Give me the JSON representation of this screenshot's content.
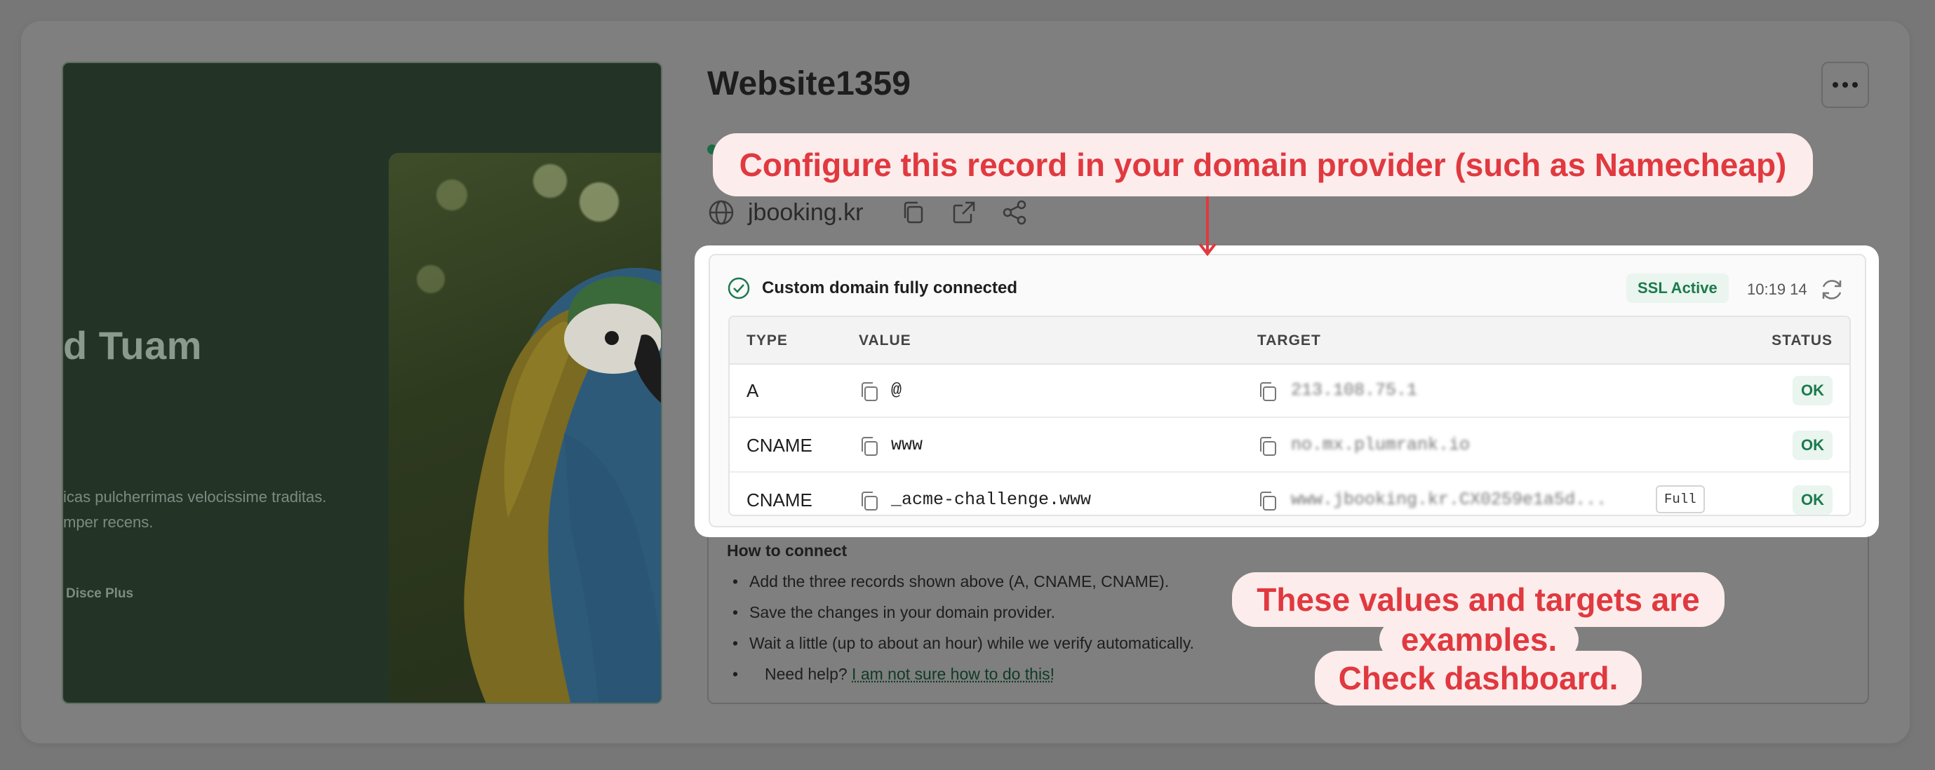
{
  "site": {
    "title": "Website1359",
    "domain": "jbooking.kr"
  },
  "preview": {
    "hero_title": "d Tuam",
    "hero_line1": "icas pulcherrimas velocissime traditas.",
    "hero_line2": "mper recens.",
    "hero_link": "Disce Plus"
  },
  "connection": {
    "status_text": "Custom domain fully connected",
    "ssl_badge": "SSL Active",
    "time": "10:19 14"
  },
  "table": {
    "headers": {
      "type": "TYPE",
      "value": "VALUE",
      "target": "TARGET",
      "status": "STATUS"
    },
    "rows": [
      {
        "type": "A",
        "value": "@",
        "target": "213.108.75.1",
        "status": "OK"
      },
      {
        "type": "CNAME",
        "value": "www",
        "target": "no.mx.plumrank.io",
        "status": "OK"
      },
      {
        "type": "CNAME",
        "value": "_acme-challenge.www",
        "target": "www.jbooking.kr.CX0259e1a5d...",
        "status": "OK",
        "full_label": "Full"
      }
    ]
  },
  "howto": {
    "title": "How to connect",
    "steps": [
      "Add the three records shown above (A, CNAME, CNAME).",
      "Save the changes in your domain provider.",
      "Wait a little (up to about an hour) while we verify automatically."
    ],
    "help_prefix": "Need help?",
    "help_link": "I am not sure how to do this!"
  },
  "callouts": {
    "top": "Configure this record in your domain provider (such as Namecheap)",
    "bottom_line1": "These values and targets are",
    "bottom_line2": "examples.",
    "bottom_line3": "Check dashboard."
  },
  "icons": {
    "globe": "globe-icon",
    "copy": "copy-icon",
    "external": "external-link-icon",
    "share": "share-icon",
    "check": "check-circle-icon",
    "refresh": "refresh-icon",
    "menu": "more-icon"
  },
  "colors": {
    "accent_green": "#1b7a4c",
    "callout_red": "#e0393f",
    "callout_bg": "#fdecec"
  }
}
